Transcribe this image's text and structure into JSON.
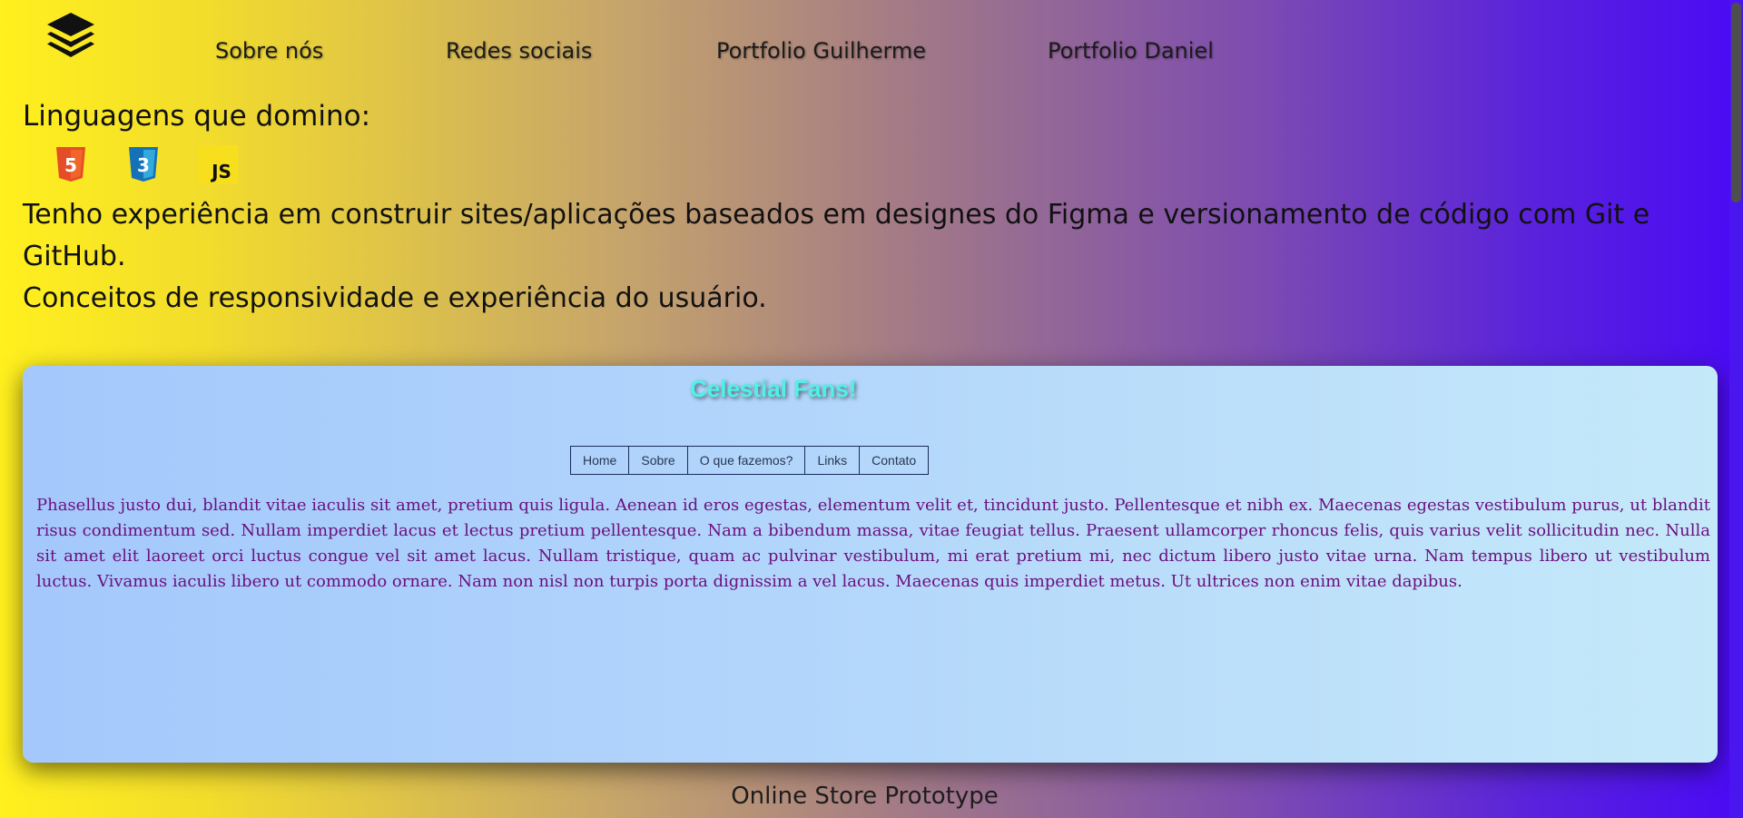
{
  "header": {
    "logo_icon": "stacked-layers-icon",
    "nav": [
      {
        "label": "Sobre nós"
      },
      {
        "label": "Redes sociais"
      },
      {
        "label": "Portfolio Guilherme"
      },
      {
        "label": "Portfolio Daniel"
      }
    ]
  },
  "skills": {
    "title": "Linguagens que domino:",
    "icons": [
      "html5-icon",
      "css3-icon",
      "javascript-icon"
    ],
    "js_badge_text": "JS",
    "html_badge_text": "5",
    "css_badge_text": "3"
  },
  "experience": {
    "line1": "Tenho experiência em construir sites/aplicações baseados em designes do Figma e versionamento de código com Git e GitHub.",
    "line2": "Conceitos de responsividade e experiência do usuário."
  },
  "project_preview": {
    "title": "Celestial Fans!",
    "nav": [
      {
        "label": "Home"
      },
      {
        "label": "Sobre"
      },
      {
        "label": "O que fazemos?"
      },
      {
        "label": "Links"
      },
      {
        "label": "Contato"
      }
    ],
    "body_text": "Phasellus justo dui, blandit vitae iaculis sit amet, pretium quis ligula. Aenean id eros egestas, elementum velit et, tincidunt justo. Pellentesque et nibh ex. Maecenas egestas vestibulum purus, ut blandit risus condimentum sed. Nullam imperdiet lacus et lectus pretium pellentesque. Nam a bibendum massa, vitae feugiat tellus. Praesent ullamcorper rhoncus felis, quis varius velit sollicitudin nec. Nulla sit amet elit laoreet orci luctus congue vel sit amet lacus. Nullam tristique, quam ac pulvinar vestibulum, mi erat pretium mi, nec dictum libero justo vitae urna. Nam tempus libero ut vestibulum luctus. Vivamus iaculis libero ut commodo ornare. Nam non nisl non turpis porta dignissim a vel lacus. Maecenas quis imperdiet metus. Ut ultrices non enim vitae dapibus."
  },
  "next_project": {
    "title": "Online Store Prototype"
  },
  "colors": {
    "gradient_start": "#fff01e",
    "gradient_end": "#4a0af5",
    "card_title": "#4ef2e7",
    "card_text": "#6b1080",
    "html5": "#e44d26",
    "css3": "#1572b6",
    "js": "#f7df1e"
  }
}
